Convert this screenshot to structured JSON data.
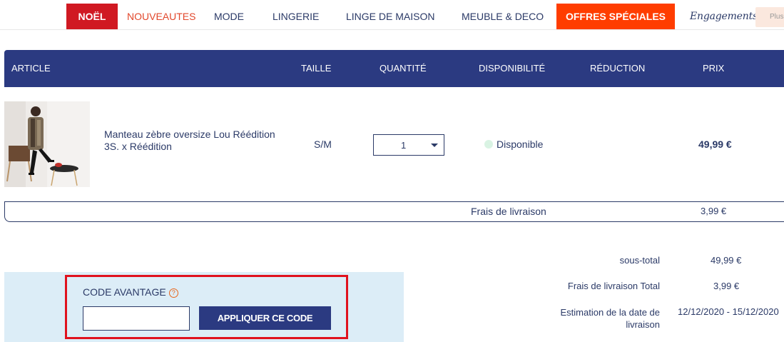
{
  "nav": {
    "noel": "NOËL",
    "nouveautes": "NOUVEAUTES",
    "mode": "MODE",
    "lingerie": "LINGERIE",
    "linge_maison": "LINGE DE MAISON",
    "meuble_deco": "MEUBLE & DECO",
    "offres": "OFFRES SPÉCIALES",
    "engagements": "Engagements",
    "plus": "Plus"
  },
  "table": {
    "headers": {
      "article": "ARTICLE",
      "taille": "TAILLE",
      "quantite": "QUANTITÉ",
      "disponibilite": "DISPONIBILITÉ",
      "reduction": "RÉDUCTION",
      "prix": "PRIX"
    },
    "item": {
      "name": "Manteau zèbre oversize Lou Réédition 3S. x Réédition",
      "size": "S/M",
      "quantity": "1",
      "availability": "Disponible",
      "price": "49,99 €"
    },
    "delivery": {
      "label": "Frais de livraison",
      "value": "3,99 €"
    }
  },
  "totals": {
    "subtotal_label": "sous-total",
    "subtotal_value": "49,99 €",
    "delivery_total_label": "Frais de livraison Total",
    "delivery_total_value": "3,99 €",
    "estimate_label": "Estimation de la date de livraison",
    "estimate_value": "12/12/2020 - 15/12/2020"
  },
  "coupon": {
    "title": "CODE AVANTAGE",
    "help": "?",
    "input_value": "",
    "button": "APPLIQUER CE CODE"
  },
  "colors": {
    "navy": "#2b3a81",
    "noel_red": "#d01922",
    "offres_orange": "#ff3d00",
    "highlight_red": "#e0121e",
    "coupon_bg": "#dcedf7"
  }
}
